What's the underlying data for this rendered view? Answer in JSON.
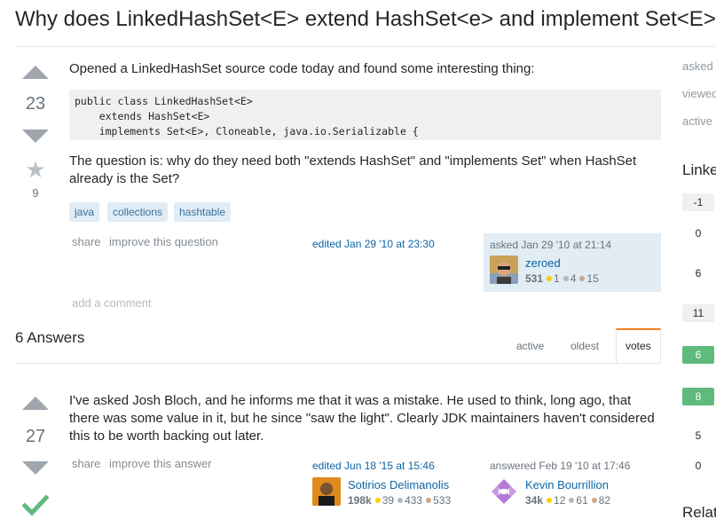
{
  "question": {
    "title": "Why does LinkedHashSet<E> extend HashSet<e> and implement Set<E>",
    "votes": "23",
    "favorites": "9",
    "body_intro": "Opened a LinkedHashSet source code today and found some interesting thing:",
    "code_lines": [
      "public class LinkedHashSet<E>",
      "    extends HashSet<E>",
      "    implements Set<E>, Cloneable, java.io.Serializable {"
    ],
    "body_question": "The question is: why do they need both \"extends HashSet\" and \"implements Set\" when HashSet already is the Set?",
    "tags": [
      "java",
      "collections",
      "hashtable"
    ],
    "share_label": "share",
    "improve_label": "improve this question",
    "edited_text": "edited Jan 29 '10 at 23:30",
    "asked_text": "asked Jan 29 '10 at 21:14",
    "owner": {
      "name": "zeroed",
      "rep": "531",
      "gold": "1",
      "silver": "4",
      "bronze": "15"
    },
    "add_comment": "add a comment"
  },
  "answers_header": "6 Answers",
  "sort_tabs": [
    "active",
    "oldest",
    "votes"
  ],
  "answer": {
    "votes": "27",
    "body": "I've asked Josh Bloch, and he informs me that it was a mistake. He used to think, long ago, that there was some value in it, but he since \"saw the light\". Clearly JDK maintainers haven't considered this to be worth backing out later.",
    "share_label": "share",
    "improve_label": "improve this answer",
    "edited_text": "edited Jun 18 '15 at 15:46",
    "editor": {
      "name": "Sotirios Delimanolis",
      "rep": "198k",
      "gold": "39",
      "silver": "433",
      "bronze": "533"
    },
    "answered_text": "answered Feb 19 '10 at 17:46",
    "author": {
      "name": "Kevin Bourrillion",
      "rep": "34k",
      "gold": "12",
      "silver": "61",
      "bronze": "82"
    },
    "accepted": true
  },
  "sidebar": {
    "stats": [
      "asked",
      "viewed",
      "active"
    ],
    "linked_heading": "Linked",
    "linked_scores": [
      {
        "score": "-1",
        "style": "normal"
      },
      {
        "score": "0",
        "style": "plain"
      },
      {
        "score": "6",
        "style": "plain"
      },
      {
        "score": "11",
        "style": "normal"
      },
      {
        "score": "6",
        "style": "accepted"
      },
      {
        "score": "8",
        "style": "accepted"
      },
      {
        "score": "5",
        "style": "plain"
      },
      {
        "score": "0",
        "style": "plain"
      }
    ],
    "related_heading": "Related"
  },
  "colors": {
    "link": "#0c65a5",
    "tag_bg": "#e1ecf4",
    "accepted": "#5eba7d",
    "tab_accent": "#f48024"
  }
}
